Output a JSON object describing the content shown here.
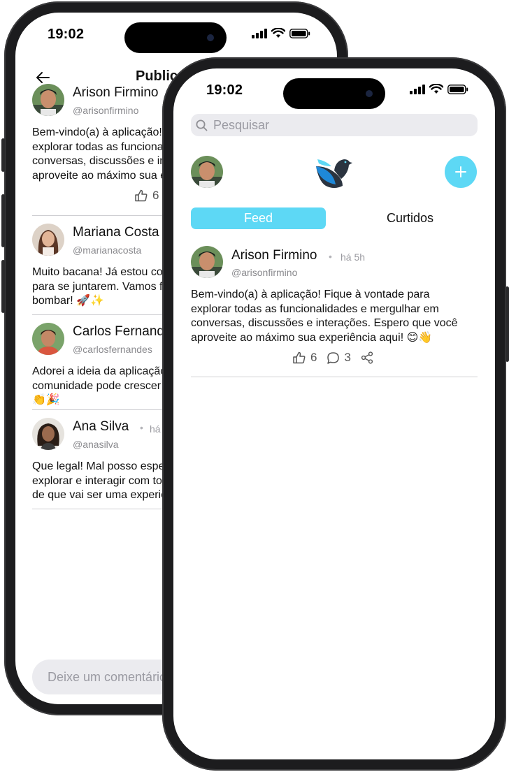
{
  "back_screen": {
    "status_time": "19:02",
    "header_title": "Publicação",
    "posts": [
      {
        "name": "Arison Firmino",
        "handle": "@arisonfirmino",
        "text": "Bem-vindo(a) à aplicação! Fique à vontade para\nexplorar todas as funcionalidades e mergulhar em\nconversas, discussões e interações. Espero que você\naproveite ao máximo sua experiência aqui! 😊👋",
        "likes": "6"
      },
      {
        "name": "Mariana Costa",
        "handle": "@marianacosta",
        "text": "Muito bacana! Já estou convidando meus amigos\npara se juntarem. Vamos fazer essa comunidade\nbombar! 🚀✨"
      },
      {
        "name": "Carlos Fernandes",
        "handle": "@carlosfernandes",
        "text": "Adorei a ideia da aplicação! Tenho certeza que essa\ncomunidade pode crescer muito. Parabéns!\n👏🎉"
      },
      {
        "name": "Ana Silva",
        "handle": "@anasilva",
        "time": "há",
        "text": "Que legal! Mal posso esperar para começar a\nexplorar e interagir com todos. Tenho certeza\nde que vai ser uma experiência incrível!"
      }
    ],
    "comment_placeholder": "Deixe um comentário"
  },
  "front_screen": {
    "status_time": "19:02",
    "search_placeholder": "Pesquisar",
    "tabs": [
      {
        "label": "Feed",
        "active": true
      },
      {
        "label": "Curtidos",
        "active": false
      }
    ],
    "post": {
      "name": "Arison Firmino",
      "time": "há 5h",
      "handle": "@arisonfirmino",
      "text": "Bem-vindo(a) à aplicação! Fique à vontade para\nexplorar todas as funcionalidades e mergulhar em\nconversas, discussões e interações. Espero que você\naproveite ao máximo sua experiência aqui! 😊👋",
      "likes": "6",
      "comments": "3"
    }
  },
  "colors": {
    "accent": "#5dd8f5",
    "logo_blue": "#1e88d8",
    "logo_dark": "#2b3440"
  },
  "icons": [
    "back-arrow-icon",
    "signal-icon",
    "wifi-icon",
    "battery-icon",
    "search-icon",
    "bird-logo-icon",
    "plus-icon",
    "like-icon",
    "comment-icon",
    "share-icon"
  ]
}
